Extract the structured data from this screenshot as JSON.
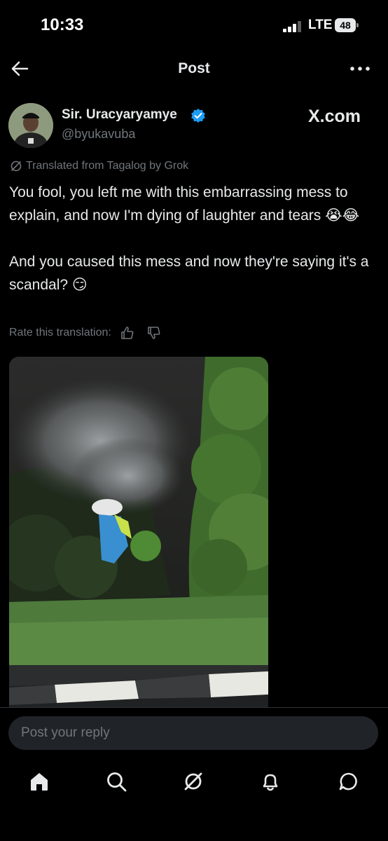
{
  "status_bar": {
    "time": "10:33",
    "network": "LTE",
    "battery": "48"
  },
  "header": {
    "title": "Post",
    "back_icon": "arrow-left-icon",
    "more_icon": "more-horizontal-icon"
  },
  "post": {
    "author_name": "Sir. Uracyaryamye",
    "author_handle": "@byukavuba",
    "verified": true,
    "source_label": "X.com",
    "translated_note": "Translated from Tagalog by Grok",
    "paragraphs": [
      "You fool, you left me with this embarrassing mess to explain, and now I'm dying of laughter and tears 😭😂",
      "And you caused this mess and now they're saying it's a scandal? 😏"
    ],
    "rate_label": "Rate this translation:"
  },
  "reply": {
    "placeholder": "Post your reply"
  },
  "nav": {
    "items": [
      {
        "icon": "home-icon",
        "active": true
      },
      {
        "icon": "search-icon",
        "active": false
      },
      {
        "icon": "grok-icon",
        "active": false
      },
      {
        "icon": "bell-icon",
        "active": false
      },
      {
        "icon": "chat-icon",
        "active": false
      }
    ]
  },
  "colors": {
    "background": "#000000",
    "text": "#e7e9ea",
    "muted": "#71767b",
    "verified": "#1d9bf0",
    "reply_bg": "#202327"
  }
}
